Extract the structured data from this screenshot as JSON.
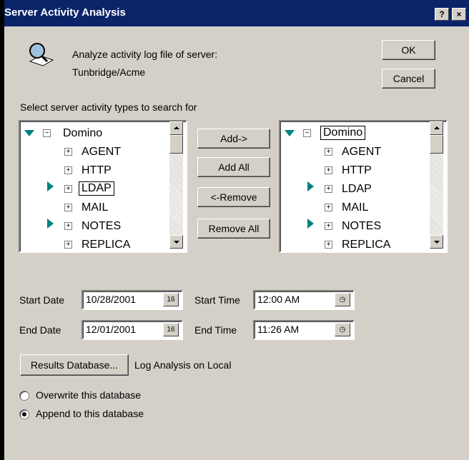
{
  "window": {
    "title": "Server Activity Analysis",
    "help_label": "?",
    "close_label": "×"
  },
  "header": {
    "line1": "Analyze activity log file of server:",
    "line2": "Tunbridge/Acme"
  },
  "buttons": {
    "ok": "OK",
    "cancel": "Cancel",
    "add": "Add->",
    "add_all": "Add All",
    "remove": "<-Remove",
    "remove_all": "Remove All",
    "results_db": "Results Database..."
  },
  "section_label": "Select server activity types to search for",
  "left_tree": {
    "root": "Domino",
    "items": [
      "AGENT",
      "HTTP",
      "LDAP",
      "MAIL",
      "NOTES",
      "REPLICA"
    ]
  },
  "right_tree": {
    "root": "Domino",
    "items": [
      "AGENT",
      "HTTP",
      "LDAP",
      "MAIL",
      "NOTES",
      "REPLICA"
    ]
  },
  "dates": {
    "start_date_label": "Start Date",
    "start_date": "10/28/2001",
    "end_date_label": "End Date",
    "end_date": "12/01/2001",
    "start_time_label": "Start Time",
    "start_time": "12:00 AM",
    "end_time_label": "End Time",
    "end_time": "11:26 AM",
    "calendar_label": "16"
  },
  "results": {
    "location": "Log Analysis on Local"
  },
  "options": {
    "overwrite": "Overwrite this database",
    "append": "Append to this database",
    "selected": "append"
  },
  "colors": {
    "titlebar": "#0a246a",
    "face": "#d4d0c8",
    "tree_marker": "#008080"
  }
}
